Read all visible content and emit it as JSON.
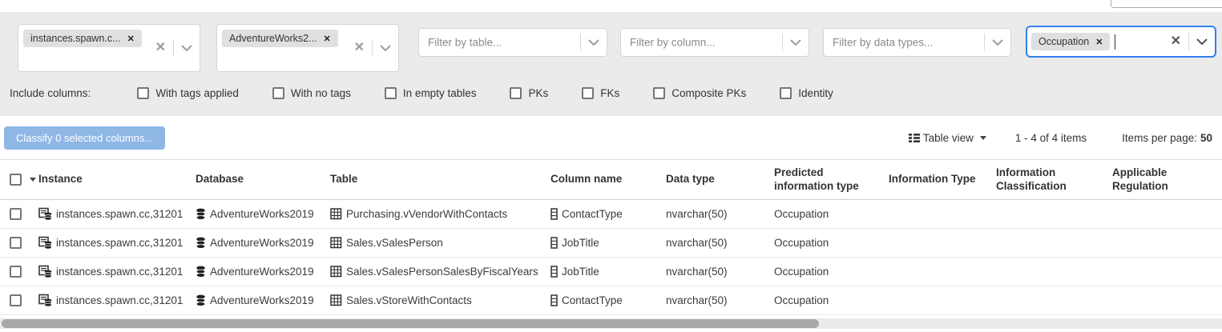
{
  "colors": {
    "accent": "#2F80ED",
    "classify_button_bg": "#8fb7e6"
  },
  "icons": {
    "chip_close": "✕",
    "clear": "✕"
  },
  "filters": {
    "instance": {
      "chip": "instances.spawn.c..."
    },
    "database": {
      "chip": "AdventureWorks2..."
    },
    "table": {
      "placeholder": "Filter by table..."
    },
    "column": {
      "placeholder": "Filter by column..."
    },
    "data_types": {
      "placeholder": "Filter by data types..."
    },
    "info_types": {
      "chip": "Occupation"
    }
  },
  "include_columns": {
    "label": "Include columns:",
    "options": [
      "With tags applied",
      "With no tags",
      "In empty tables",
      "PKs",
      "FKs",
      "Composite PKs",
      "Identity"
    ]
  },
  "toolbar": {
    "classify_button": "Classify 0 selected columns...",
    "view_label": "Table view",
    "range": "1 - 4 of 4 items",
    "per_page_label": "Items per page:",
    "per_page_value": "50"
  },
  "table": {
    "headers": [
      "Instance",
      "Database",
      "Table",
      "Column name",
      "Data type",
      "Predicted information type",
      "Information Type",
      "Information Classification",
      "Applicable Regulation"
    ],
    "rows": [
      {
        "instance": "instances.spawn.cc,31201",
        "database": "AdventureWorks2019",
        "table": "Purchasing.vVendorWithContacts",
        "column": "ContactType",
        "data_type": "nvarchar(50)",
        "predicted": "Occupation",
        "information_type": "",
        "classification": "",
        "regulation": ""
      },
      {
        "instance": "instances.spawn.cc,31201",
        "database": "AdventureWorks2019",
        "table": "Sales.vSalesPerson",
        "column": "JobTitle",
        "data_type": "nvarchar(50)",
        "predicted": "Occupation",
        "information_type": "",
        "classification": "",
        "regulation": ""
      },
      {
        "instance": "instances.spawn.cc,31201",
        "database": "AdventureWorks2019",
        "table": "Sales.vSalesPersonSalesByFiscalYears",
        "column": "JobTitle",
        "data_type": "nvarchar(50)",
        "predicted": "Occupation",
        "information_type": "",
        "classification": "",
        "regulation": ""
      },
      {
        "instance": "instances.spawn.cc,31201",
        "database": "AdventureWorks2019",
        "table": "Sales.vStoreWithContacts",
        "column": "ContactType",
        "data_type": "nvarchar(50)",
        "predicted": "Occupation",
        "information_type": "",
        "classification": "",
        "regulation": ""
      }
    ]
  }
}
